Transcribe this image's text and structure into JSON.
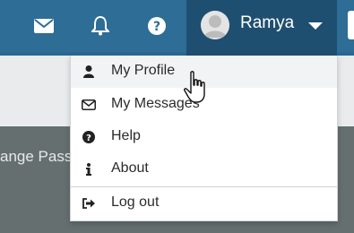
{
  "header": {
    "icons": [
      "envelope-icon",
      "bell-icon",
      "question-circle-icon"
    ],
    "user": {
      "name": "Ramya",
      "avatar_icon": "user-avatar"
    }
  },
  "background": {
    "panel_text": "ange Pass"
  },
  "menu": {
    "items": [
      {
        "label": "My Profile",
        "icon": "user-icon"
      },
      {
        "label": "My Messages",
        "icon": "envelope-outline-icon"
      },
      {
        "label": "Help",
        "icon": "question-circle-icon"
      },
      {
        "label": "About",
        "icon": "info-icon"
      },
      {
        "label": "Log out",
        "icon": "sign-out-icon"
      }
    ]
  },
  "colors": {
    "topbar": "#2e6d95",
    "user_button": "#1f4f70",
    "panel": "#656f70"
  }
}
